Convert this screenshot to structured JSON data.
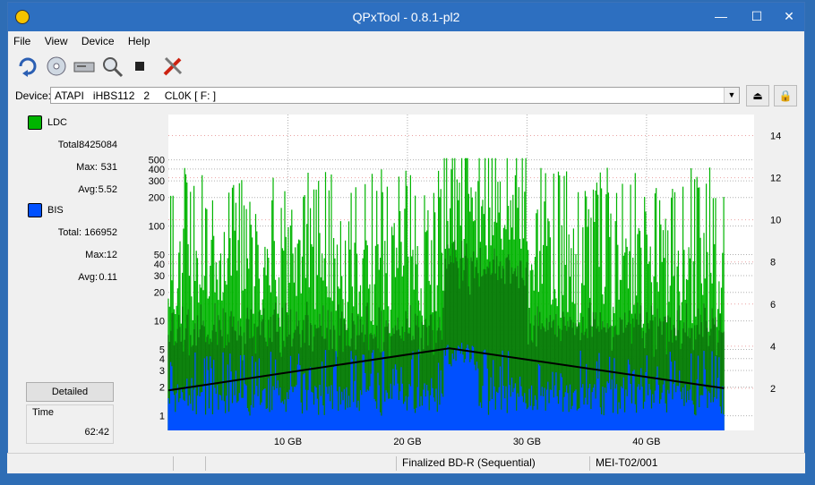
{
  "window": {
    "title": "QPxTool - 0.8.1-pl2"
  },
  "menu": [
    "File",
    "View",
    "Device",
    "Help"
  ],
  "toolbar": {
    "icons": [
      "refresh-icon",
      "disc-info-icon",
      "drive-icon",
      "scan-icon",
      "stop-icon",
      "tools-icon"
    ]
  },
  "device": {
    "label": "Device:",
    "value": "ATAPI   iHBS112   2     CL0K [ F: ]"
  },
  "legend": {
    "ldc": {
      "name": "LDC",
      "color": "#00b400",
      "total_label": "Total:",
      "total": "8425084",
      "max_label": "Max:",
      "max": "531",
      "avg_label": "Avg:",
      "avg": "5.52"
    },
    "bis": {
      "name": "BIS",
      "color": "#0050ff",
      "total_label": "Total:",
      "total": "166952",
      "max_label": "Max:",
      "max": "12",
      "avg_label": "Avg:",
      "avg": "0.11"
    }
  },
  "detailed_label": "Detailed",
  "time": {
    "label": "Time",
    "value": "62:42"
  },
  "status": {
    "disc": "Finalized BD-R (Sequential)",
    "media": "MEI-T02/001"
  },
  "chart_data": {
    "type": "area",
    "x_ticks": [
      "10 GB",
      "20 GB",
      "30 GB",
      "40 GB"
    ],
    "x_tick_values": [
      10,
      20,
      30,
      40
    ],
    "xlim": [
      0,
      49
    ],
    "y_left_ticks": [
      "1",
      "2",
      "3",
      "4",
      "5",
      "10",
      "20",
      "30",
      "40",
      "50",
      "100",
      "200",
      "300",
      "400",
      "500"
    ],
    "y_left_values": [
      1,
      2,
      3,
      4,
      5,
      10,
      20,
      30,
      40,
      50,
      100,
      200,
      300,
      400,
      500
    ],
    "y_left_scale": "log",
    "y_right_ticks": [
      "2",
      "4",
      "6",
      "8",
      "10",
      "12",
      "14"
    ],
    "y_right_values": [
      2,
      4,
      6,
      8,
      10,
      12,
      14
    ],
    "y_right_lim": [
      0,
      15
    ],
    "data_end_gb": 46.5,
    "series": [
      {
        "name": "LDC",
        "color": "#00b400"
      },
      {
        "name": "BIS",
        "color": "#0050ff"
      }
    ],
    "speed_curve": {
      "x": [
        0,
        23.5,
        46.5
      ],
      "y": [
        1.9,
        3.9,
        2.0
      ]
    },
    "grid": true
  },
  "colors": {
    "titlebar": "#2d6fc0",
    "plot_bg": "#ffffff"
  }
}
